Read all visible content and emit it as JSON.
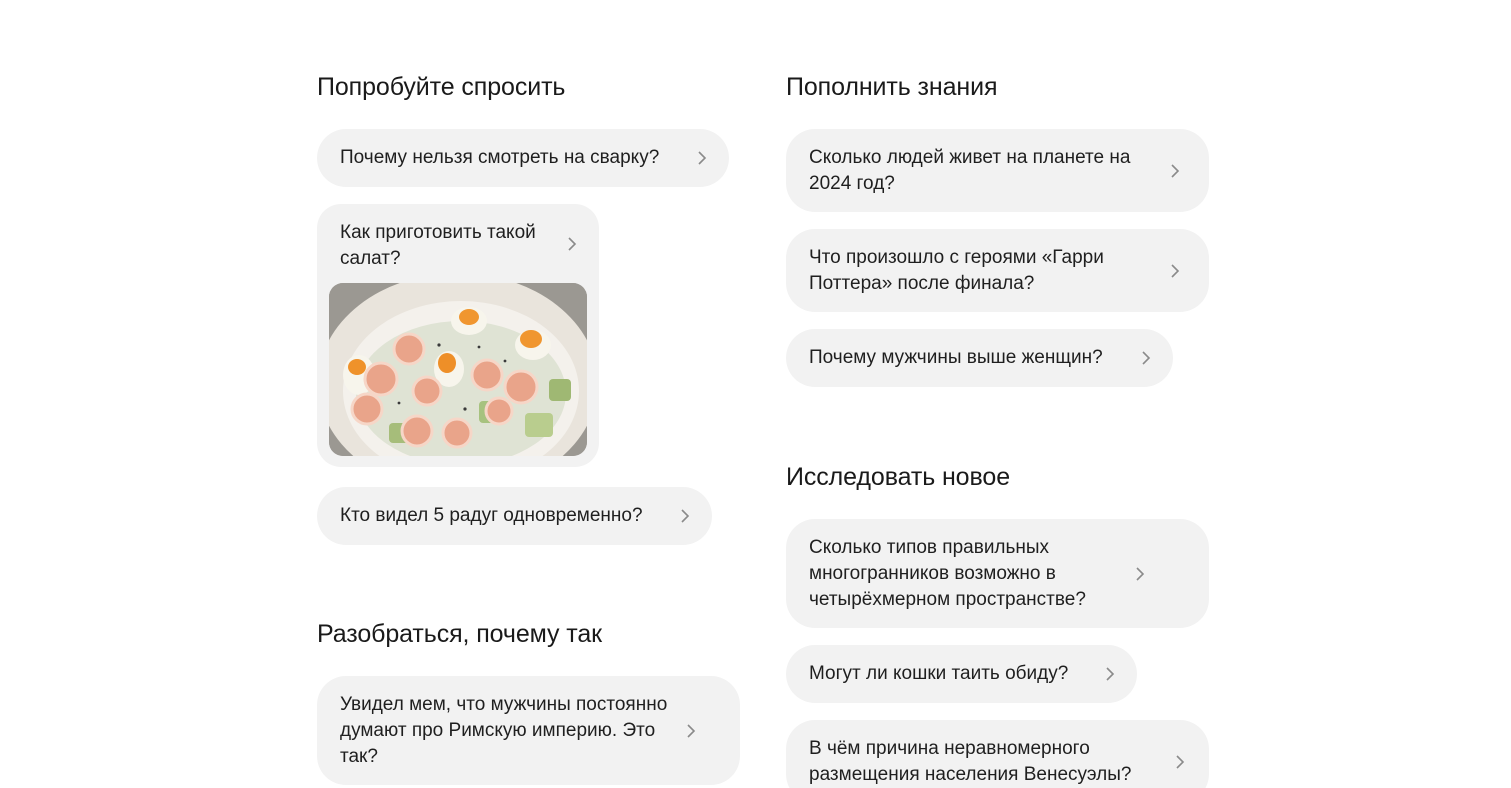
{
  "sections": {
    "try_asking": {
      "title": "Попробуйте спросить",
      "q1": "Почему нельзя смотреть на сварку?",
      "q2": "Как приготовить такой салат?",
      "q3": "Кто видел 5 радуг одновременно?"
    },
    "why": {
      "title": "Разобраться, почему так",
      "q1": "Увидел мем, что мужчины постоянно думают про Римскую империю. Это так?"
    },
    "knowledge": {
      "title": "Пополнить знания",
      "q1": "Сколько людей живет на планете на 2024 год?",
      "q2": "Что произошло с героями «Гарри Поттера» после финала?",
      "q3": "Почему мужчины выше женщин?"
    },
    "explore": {
      "title": "Исследовать новое",
      "q1": "Сколько типов правильных многогранников возможно в четырёхмерном пространстве?",
      "q2": "Могут ли кошки таить обиду?",
      "q3": "В чём причина неравномерного размещения населения Венесуэлы?"
    }
  },
  "icons": {
    "chevron": "chevron-right-icon"
  },
  "colors": {
    "chip_bg": "#f2f2f2",
    "text": "#1f1f1f",
    "chevron": "#8a8a8a"
  }
}
